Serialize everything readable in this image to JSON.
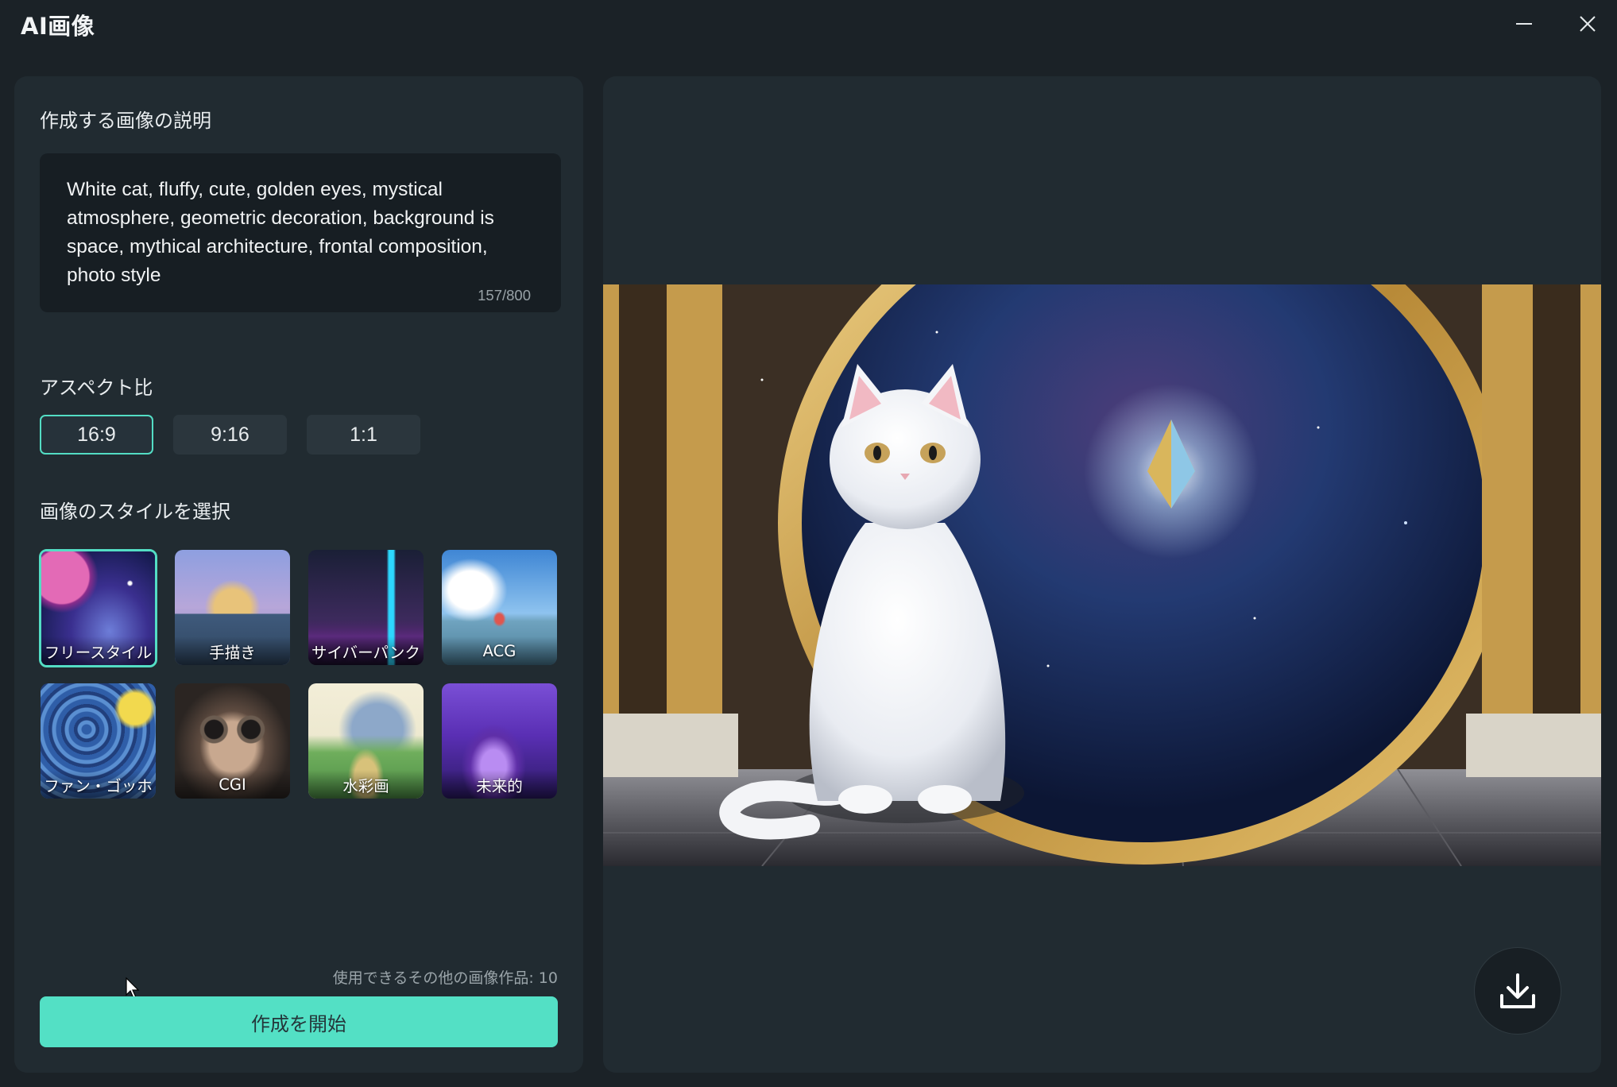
{
  "app": {
    "title": "AI画像"
  },
  "window_controls": {
    "minimize_icon": "minimize-icon",
    "close_icon": "close-icon"
  },
  "left_panel": {
    "prompt_section": {
      "label": "作成する画像の説明",
      "value": "White cat, fluffy, cute, golden eyes, mystical atmosphere, geometric decoration, background is space, mythical architecture, frontal composition, photo style",
      "char_count": "157/800"
    },
    "aspect_section": {
      "label": "アスペクト比",
      "options": [
        {
          "label": "16:9",
          "selected": true
        },
        {
          "label": "9:16",
          "selected": false
        },
        {
          "label": "1:1",
          "selected": false
        }
      ]
    },
    "style_section": {
      "label": "画像のスタイルを選択",
      "styles": [
        {
          "label": "フリースタイル",
          "selected": true
        },
        {
          "label": "手描き",
          "selected": false
        },
        {
          "label": "サイバーパンク",
          "selected": false
        },
        {
          "label": "ACG",
          "selected": false
        },
        {
          "label": "ファン・ゴッホ",
          "selected": false
        },
        {
          "label": "CGI",
          "selected": false
        },
        {
          "label": "水彩画",
          "selected": false
        },
        {
          "label": "未来的",
          "selected": false
        }
      ]
    },
    "credits_text": "使用できるその他の画像作品: 10",
    "start_button": "作成を開始"
  },
  "right_panel": {
    "preview_icon": "white-cat-space-portal-image",
    "download_icon": "download-icon"
  },
  "colors": {
    "accent": "#53e0c5",
    "window_bg": "#1b2227",
    "panel_bg": "#212b31",
    "input_bg": "#171e23"
  }
}
